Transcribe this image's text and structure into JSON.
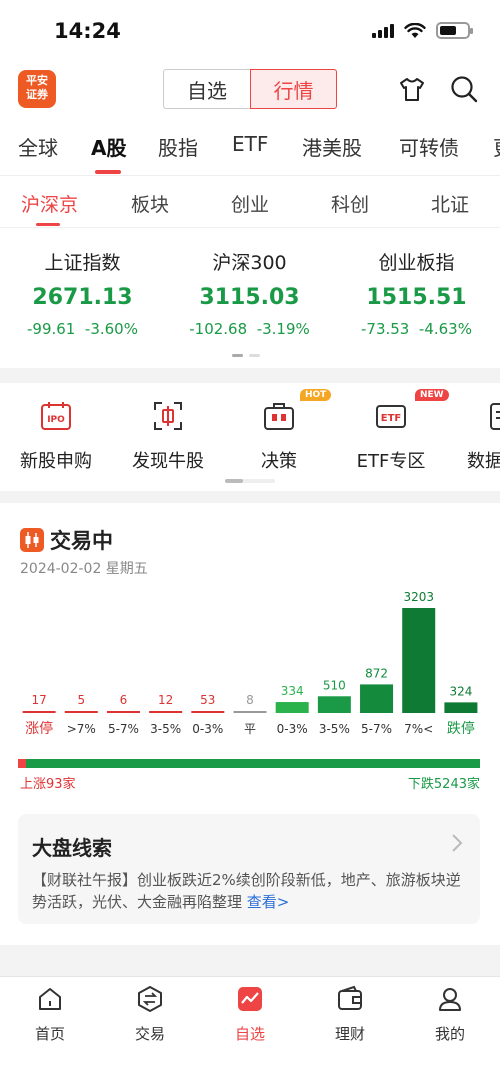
{
  "status": {
    "time": "14:24"
  },
  "header": {
    "logo_text_line1": "平安",
    "logo_text_line2": "证券",
    "segment": [
      "自选",
      "行情"
    ],
    "active_segment": "行情"
  },
  "market_tabs": [
    "全球",
    "A股",
    "股指",
    "ETF",
    "港美股",
    "可转债",
    "更"
  ],
  "sub_tabs": [
    "沪深京",
    "板块",
    "创业",
    "科创",
    "北证"
  ],
  "indices": [
    {
      "name": "上证指数",
      "value": "2671.13",
      "change": "-99.61",
      "pct": "-3.60%"
    },
    {
      "name": "沪深300",
      "value": "3115.03",
      "change": "-102.68",
      "pct": "-3.19%"
    },
    {
      "name": "创业板指",
      "value": "1515.51",
      "change": "-73.53",
      "pct": "-4.63%"
    }
  ],
  "shortcuts": [
    {
      "label": "新股申购",
      "icon_text": "IPO"
    },
    {
      "label": "发现牛股"
    },
    {
      "label": "决策",
      "badge": "HOT"
    },
    {
      "label": "ETF专区",
      "icon_text": "ETF",
      "badge": "NEW"
    },
    {
      "label": "数据"
    }
  ],
  "trade": {
    "title": "交易中",
    "date": "2024-02-02 星期五"
  },
  "chart_data": {
    "type": "bar",
    "title": "",
    "categories": [
      "涨停",
      ">7%",
      "5-7%",
      "3-5%",
      "0-3%",
      "平",
      "0-3%",
      "3-5%",
      "5-7%",
      "7%<",
      "跌停"
    ],
    "values": [
      17,
      5,
      6,
      12,
      53,
      8,
      334,
      510,
      872,
      3203,
      324
    ],
    "colors": [
      "#d33",
      "#d33",
      "#d33",
      "#d33",
      "#d33",
      "#999",
      "#2bb24c",
      "#1a9a46",
      "#138a3c",
      "#0f7a33",
      "#0f7a33"
    ],
    "label_colors": [
      "#d33",
      "#333",
      "#333",
      "#333",
      "#333",
      "#333",
      "#333",
      "#333",
      "#333",
      "#333",
      "#1a9a46"
    ],
    "grid": false
  },
  "breadth": {
    "rise_label": "上涨93家",
    "fall_label": "下跌5243家",
    "rise_fraction": 0.0174
  },
  "clue": {
    "title": "大盘线索",
    "text": "【财联社午报】创业板跌近2%续创阶段新低，地产、旅游板块逆势活跃，光伏、大金融再陷整理",
    "more": "查看>"
  },
  "bottom_nav": [
    {
      "label": "首页"
    },
    {
      "label": "交易"
    },
    {
      "label": "自选"
    },
    {
      "label": "理财"
    },
    {
      "label": "我的"
    }
  ],
  "colors": {
    "accent": "#e44",
    "down": "#1a9a46",
    "up": "#d33"
  }
}
